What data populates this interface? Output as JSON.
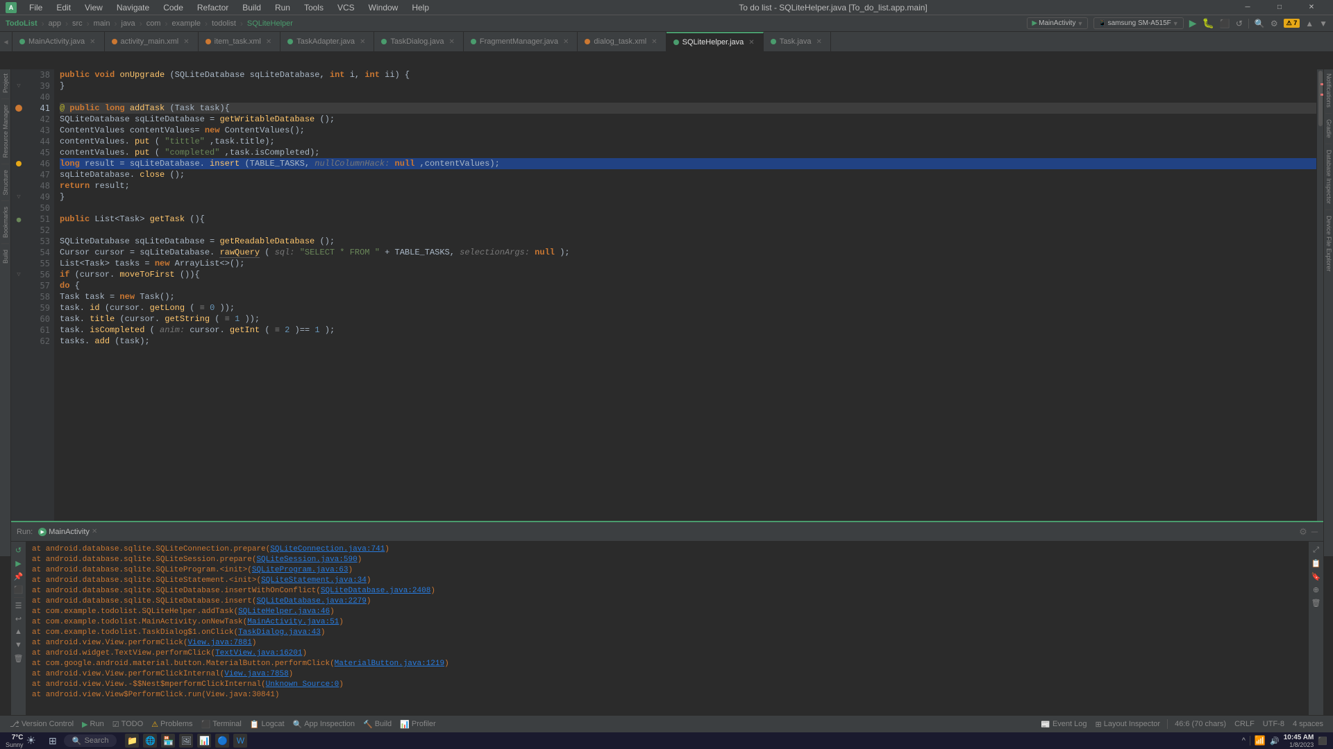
{
  "window": {
    "title": "To do list - SQLiteHelper.java [To_do_list.app.main]",
    "minimize": "─",
    "maximize": "□",
    "close": "✕"
  },
  "menu": {
    "items": [
      "File",
      "Edit",
      "View",
      "Navigate",
      "Code",
      "Refactor",
      "Build",
      "Run",
      "Tools",
      "VCS",
      "Window",
      "Help"
    ]
  },
  "breadcrumb": {
    "path": [
      "TodoList",
      "app",
      "src",
      "main",
      "java",
      "com",
      "example",
      "todolist",
      "SQLiteHelper"
    ]
  },
  "tabs": [
    {
      "name": "MainActivity.java",
      "type": "java",
      "active": false,
      "modified": false
    },
    {
      "name": "activity_main.xml",
      "type": "xml",
      "active": false,
      "modified": false
    },
    {
      "name": "item_task.xml",
      "type": "xml",
      "active": false,
      "modified": false
    },
    {
      "name": "TaskAdapter.java",
      "type": "java",
      "active": false,
      "modified": false
    },
    {
      "name": "TaskDialog.java",
      "type": "java",
      "active": false,
      "modified": false
    },
    {
      "name": "FragmentManager.java",
      "type": "java",
      "active": false,
      "modified": false
    },
    {
      "name": "dialog_task.xml",
      "type": "xml",
      "active": false,
      "modified": false
    },
    {
      "name": "SQLiteHelper.java",
      "type": "java",
      "active": true,
      "modified": false
    },
    {
      "name": "Task.java",
      "type": "java",
      "active": false,
      "modified": false
    }
  ],
  "code_lines": [
    {
      "num": 38,
      "indent": 0,
      "content": "    public void onUpgrade(SQLiteDatabase sqLiteDatabase, int i, int ii) {",
      "type": "normal"
    },
    {
      "num": 39,
      "indent": 0,
      "content": "    }",
      "type": "normal"
    },
    {
      "num": 40,
      "indent": 0,
      "content": "",
      "type": "normal"
    },
    {
      "num": 41,
      "indent": 0,
      "content": "    public long addTask(Task task){",
      "type": "breakpoint"
    },
    {
      "num": 42,
      "indent": 0,
      "content": "        SQLiteDatabase sqLiteDatabase = getWritableDatabase();",
      "type": "normal"
    },
    {
      "num": 43,
      "indent": 0,
      "content": "        ContentValues contentValues= new ContentValues();",
      "type": "normal"
    },
    {
      "num": 44,
      "indent": 0,
      "content": "        contentValues.put(\"tittle\",task.title);",
      "type": "normal"
    },
    {
      "num": 45,
      "indent": 0,
      "content": "        contentValues.put(\"completed\",task.isCompleted);",
      "type": "normal"
    },
    {
      "num": 46,
      "indent": 0,
      "content": "        long result = sqLiteDatabase.insert(TABLE_TASKS, nullColumnHack: null,contentValues);",
      "type": "selected"
    },
    {
      "num": 47,
      "indent": 0,
      "content": "        sqLiteDatabase.close();",
      "type": "normal"
    },
    {
      "num": 48,
      "indent": 0,
      "content": "        return result;",
      "type": "normal"
    },
    {
      "num": 49,
      "indent": 0,
      "content": "    }",
      "type": "normal"
    },
    {
      "num": 50,
      "indent": 0,
      "content": "",
      "type": "normal"
    },
    {
      "num": 51,
      "indent": 0,
      "content": "    public List<Task> getTask(){",
      "type": "normal"
    },
    {
      "num": 52,
      "indent": 0,
      "content": "",
      "type": "normal"
    },
    {
      "num": 53,
      "indent": 0,
      "content": "        SQLiteDatabase sqLiteDatabase = getReadableDatabase();",
      "type": "normal"
    },
    {
      "num": 54,
      "indent": 0,
      "content": "        Cursor cursor = sqLiteDatabase.rawQuery( sql: \"SELECT * FROM \"+ TABLE_TASKS, selectionArgs: null);",
      "type": "normal"
    },
    {
      "num": 55,
      "indent": 0,
      "content": "        List<Task> tasks = new ArrayList<>();",
      "type": "normal"
    },
    {
      "num": 56,
      "indent": 0,
      "content": "        if (cursor.moveToFirst()){",
      "type": "normal"
    },
    {
      "num": 57,
      "indent": 0,
      "content": "            do {",
      "type": "normal"
    },
    {
      "num": 58,
      "indent": 0,
      "content": "                Task task = new Task();",
      "type": "normal"
    },
    {
      "num": 59,
      "indent": 0,
      "content": "                task.id(cursor.getLong( ≡ 0));",
      "type": "normal"
    },
    {
      "num": 60,
      "indent": 0,
      "content": "                task.title(cursor.getString( ≡ 1));",
      "type": "normal"
    },
    {
      "num": 61,
      "indent": 0,
      "content": "                task.isCompleted( anim: cursor.getInt( ≡ 2)==1);",
      "type": "normal"
    },
    {
      "num": 62,
      "indent": 0,
      "content": "                tasks.add(task);",
      "type": "normal"
    }
  ],
  "bottom_panel": {
    "run_tab": "Run:",
    "main_activity_tab": "MainActivity",
    "gear_icon": "⚙",
    "minimize_icon": "─"
  },
  "log_lines": [
    "    at android.database.sqlite.SQLiteConnection.prepare(SQLiteConnection.java:741)",
    "    at android.database.sqlite.SQLiteSession.prepare(SQLiteSession.java:590)",
    "    at android.database.sqlite.SQLiteProgram.<init>(SQLiteProgram.java:63)",
    "    at android.database.sqlite.SQLiteStatement.<init>(SQLiteStatement.java:34)",
    "    at android.database.sqlite.SQLiteDatabase.insertWithOnConflict(SQLiteDatabase.java:2408)",
    "    at android.database.sqlite.SQLiteDatabase.insert(SQLiteDatabase.java:2279)",
    "    at com.example.todolist.SQLiteHelper.addTask(SQLiteHelper.java:46)",
    "    at com.example.todolist.MainActivity.onNewTask(MainActivity.java:51)",
    "    at com.example.todolist.TaskDialog$1.onClick(TaskDialog.java:43)",
    "    at android.view.View.performClick(View.java:7881)",
    "    at android.widget.TextView.performClick(TextView.java:16201)",
    "    at com.google.android.material.button.MaterialButton.performClick(MaterialButton.java:1219)",
    "    at android.view.View.performClickInternal(View.java:7858)",
    "    at android.view.View.-$$Nest$mperformClickInternal(Unknown Source:0)",
    "    at android.view.View$PerformClick.run(View.java:30841)"
  ],
  "log_links": {
    "SQLiteConnection_java_741": "SQLiteConnection.java:741",
    "SQLiteSession_java_590": "SQLiteSession.java:590",
    "SQLiteProgram_java_63": "SQLiteProgram.java:63",
    "SQLiteStatement_java_34": "SQLiteStatement.java:34",
    "SQLiteDatabase_java_2408": "SQLiteDatabase.java:2408",
    "SQLiteDatabase_java_2279": "SQLiteDatabase.java:2279",
    "SQLiteHelper_java_46": "SQLiteHelper.java:46",
    "MainActivity_java_51": "MainActivity.java:51",
    "TaskDialog_java_43": "TaskDialog.java:43",
    "View_java_7881": "View.java:7881",
    "TextView_java_16201": "TextView.java:16201",
    "MaterialButton_java_1219": "MaterialButton.java:1219",
    "View_java_7858": "View.java:7858",
    "Unknown_Source_0": "Unknown Source:0"
  },
  "status_bar": {
    "git_icon": "⎇",
    "version_control": "Version Control",
    "run_label": "Run",
    "todo_label": "TODO",
    "problems_icon": "⚠",
    "problems_label": "Problems",
    "terminal_label": "Terminal",
    "logcat_label": "Logcat",
    "app_inspection": "App Inspection",
    "build_label": "Build",
    "profiler_label": "Profiler",
    "event_log": "Event Log",
    "layout_inspector": "Layout Inspector",
    "position": "46:6 (70 chars)",
    "line_sep": "CRLF",
    "encoding": "UTF-8",
    "indent": "4 spaces"
  },
  "taskbar": {
    "start_icon": "⊞",
    "search_placeholder": "Search",
    "weather_temp": "7°C",
    "weather_desc": "Sunny",
    "time": "10:45 AM",
    "date": "1/8/2023"
  },
  "right_panel_labels": [
    "Notifications",
    "Gradle",
    "Database Inspector",
    "Device File Explorer"
  ],
  "left_panel_labels": [
    "Project",
    "Bookmarks",
    "Build",
    "Resource Manager",
    "Structure"
  ]
}
